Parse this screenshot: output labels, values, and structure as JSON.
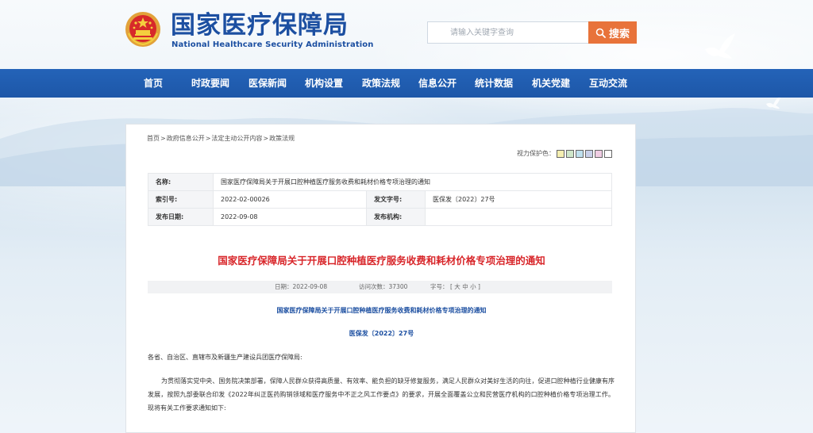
{
  "header": {
    "logo_cn": "国家医疗保障局",
    "logo_en": "National Healthcare Security Administration",
    "search_placeholder": "请输入关键字查询",
    "search_button": "搜索"
  },
  "nav": {
    "items": [
      "首页",
      "时政要闻",
      "医保新闻",
      "机构设置",
      "政策法规",
      "信息公开",
      "统计数据",
      "机关党建",
      "互动交流"
    ]
  },
  "breadcrumb": [
    "首页",
    "政府信息公开",
    "法定主动公开内容",
    "政策法规"
  ],
  "breadcrumb_sep": ">",
  "vision": {
    "label": "视力保护色：",
    "swatches": [
      "#f5efb1",
      "#cfe6c9",
      "#bfe0ee",
      "#c9d0ea",
      "#f0cde3",
      "#ffffff"
    ]
  },
  "info": {
    "name_label": "名称:",
    "name_value": "国家医疗保障局关于开展口腔种植医疗服务收费和耗材价格专项治理的通知",
    "index_label": "索引号:",
    "index_value": "2022-02-00026",
    "docno_label": "发文字号:",
    "docno_value": "医保发〔2022〕27号",
    "date_label": "发布日期:",
    "date_value": "2022-09-08",
    "org_label": "发布机构:",
    "org_value": ""
  },
  "article": {
    "title": "国家医疗保障局关于开展口腔种植医疗服务收费和耗材价格专项治理的通知",
    "meta_date": "日期：2022-09-08",
    "meta_views": "访问次数：37300",
    "meta_font_label": "字号：",
    "meta_font_sizes": "[ 大 中 小 ]",
    "subtitle": "国家医疗保障局关于开展口腔种植医疗服务收费和耗材价格专项治理的通知",
    "doc_no": "医保发〔2022〕27号",
    "salutation": "各省、自治区、直辖市及新疆生产建设兵团医疗保障局:",
    "paragraph": "为贯彻落实党中央、国务院决策部署，保障人民群众获得高质量、有效率、能负担的缺牙修复服务，满足人民群众对美好生活的向往，促进口腔种植行业健康有序发展，按照九部委联合印发《2022年纠正医药购销领域和医疗服务中不正之风工作要点》的要求，开展全面覆盖公立和民营医疗机构的口腔种植价格专项治理工作。现将有关工作要求通知如下:"
  }
}
